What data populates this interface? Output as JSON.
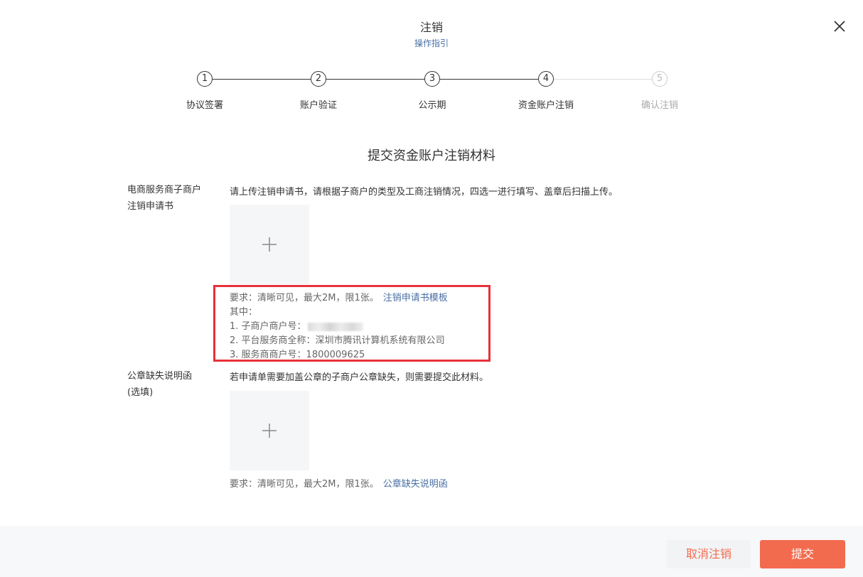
{
  "header": {
    "title": "注销",
    "guide_link": "操作指引"
  },
  "steps": [
    {
      "num": "1",
      "label": "协议签署",
      "status": "done"
    },
    {
      "num": "2",
      "label": "账户验证",
      "status": "done"
    },
    {
      "num": "3",
      "label": "公示期",
      "status": "done"
    },
    {
      "num": "4",
      "label": "资金账户注销",
      "status": "current"
    },
    {
      "num": "5",
      "label": "确认注销",
      "status": "pending"
    }
  ],
  "section_title": "提交资金账户注销材料",
  "application": {
    "label_line1": "电商服务商子商户",
    "label_line2": "注销申请书",
    "description": "请上传注销申请书，请根据子商户的类型及工商注销情况，四选一进行填写、盖章后扫描上传。",
    "requirement": "要求：清晰可见，最大2M，限1张。",
    "template_link": "注销申请书模板",
    "note_heading": "其中：",
    "sub_merchant_label": "1. 子商户商户号：",
    "platform_label": "2. 平台服务商全称：",
    "platform_value": "深圳市腾讯计算机系统有限公司",
    "service_merchant_label": "3. 服务商商户号：",
    "service_merchant_value": "1800009625"
  },
  "seal_missing": {
    "label_line1": "公章缺失说明函",
    "label_line2": "(选填)",
    "description": "若申请单需要加盖公章的子商户公章缺失，则需要提交此材料。",
    "requirement": "要求：清晰可见，最大2M，限1张。",
    "template_link": "公章缺失说明函"
  },
  "footer": {
    "cancel_label": "取消注销",
    "submit_label": "提交"
  },
  "colors": {
    "accent": "#f26b4e",
    "link": "#4a6fa5",
    "highlight": "#e8303a"
  },
  "icons": {
    "close": "close-icon",
    "upload": "plus-icon"
  }
}
